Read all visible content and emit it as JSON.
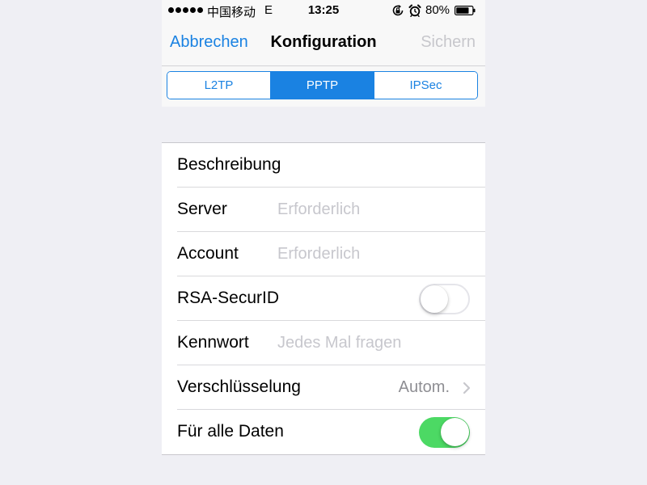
{
  "status_bar": {
    "carrier": "中国移动",
    "network": "E",
    "time": "13:25",
    "battery_percent": "80%",
    "battery_level": 0.8,
    "icons": [
      "signal-dots-icon",
      "rotation-lock-icon",
      "alarm-icon",
      "battery-icon"
    ]
  },
  "nav": {
    "cancel_label": "Abbrechen",
    "title": "Konfiguration",
    "save_label": "Sichern"
  },
  "segments": {
    "items": [
      "L2TP",
      "PPTP",
      "IPSec"
    ],
    "selected": "PPTP"
  },
  "form": {
    "description": {
      "label": "Beschreibung",
      "value": "",
      "placeholder": ""
    },
    "server": {
      "label": "Server",
      "value": "",
      "placeholder": "Erforderlich"
    },
    "account": {
      "label": "Account",
      "value": "",
      "placeholder": "Erforderlich"
    },
    "rsa": {
      "label": "RSA-SecurID",
      "enabled": false
    },
    "password": {
      "label": "Kennwort",
      "value": "",
      "placeholder": "Jedes Mal fragen"
    },
    "encryption": {
      "label": "Verschlüsselung",
      "value": "Autom."
    },
    "send_all": {
      "label": "Für alle Daten",
      "enabled": true
    }
  },
  "colors": {
    "accent": "#1a82e2",
    "toggle_on": "#4cd964",
    "disabled_text": "#c7c7cc",
    "background": "#efeff4"
  }
}
